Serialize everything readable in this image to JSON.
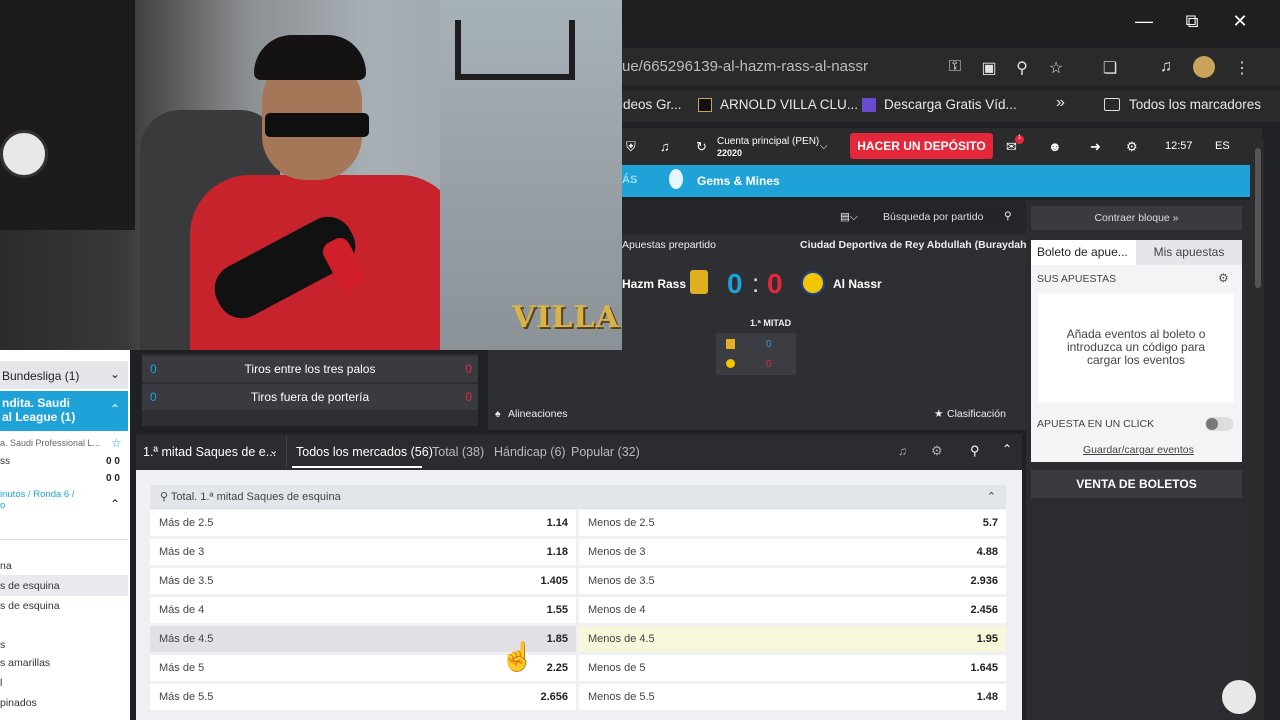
{
  "browser": {
    "url": "ue/665296139-al-hazm-rass-al-nassr",
    "bookmarks": [
      "ideos Gr...",
      "ARNOLD VILLA CLU...",
      "Descarga Gratis Víd...",
      "»",
      "Todos los marcadores"
    ],
    "window_controls": [
      "minimize-icon",
      "restore-icon",
      "close-icon"
    ]
  },
  "site_header": {
    "account_label": "Cuenta principal (PEN)",
    "account_value": "22020",
    "deposit_label": "HACER UN DEPÓSITO",
    "time": "12:57",
    "lang": "ES",
    "notification_count": "1"
  },
  "nav": {
    "mas": "ÁS",
    "gems": "Gems & Mines"
  },
  "match": {
    "search_placeholder": "Búsqueda por partido",
    "prematch": "Apuestas prepartido",
    "venue": "Ciudad Deportiva de Rey Abdullah (Buraydah)",
    "home_team": "Hazm Rass",
    "away_team": "Al Nassr",
    "home_score": "0",
    "away_score": "0",
    "period_label": "1.ª MITAD",
    "period_home": "0",
    "period_away": "0",
    "lineups": "Alineaciones",
    "standings": "Clasificación"
  },
  "left_panel": {
    "league1": "Bundesliga (1)",
    "league2_line1": "ndita. Saudi",
    "league2_line2": "al League (1)",
    "sub_league": "a. Saudi Professional L...",
    "team1": "ss",
    "team1_score": "0 0",
    "team2_score": "0 0",
    "round_line1": "inutos / Ronda 6 /",
    "round_line2": "o",
    "items": [
      "na",
      "s de esquina",
      "s de esquina",
      "s",
      "s amarillas",
      "l",
      "pinados"
    ]
  },
  "stats": [
    {
      "home": "0",
      "label": "Tiros entre los tres palos",
      "away": "0"
    },
    {
      "home": "0",
      "label": "Tiros fuera de portería",
      "away": "0"
    }
  ],
  "markets": {
    "selected": "1.ª mitad Saques de e...",
    "tabs": [
      "Todos los mercados (56)",
      "Total (38)",
      "Hándicap (6)",
      "Popular (32)"
    ],
    "group_title": "Total. 1.ª mitad Saques de esquina",
    "rows": [
      {
        "over": "Más de 2.5",
        "over_odd": "1.14",
        "under": "Menos de 2.5",
        "under_odd": "5.7"
      },
      {
        "over": "Más de 3",
        "over_odd": "1.18",
        "under": "Menos de 3",
        "under_odd": "4.88"
      },
      {
        "over": "Más de 3.5",
        "over_odd": "1.405",
        "under": "Menos de 3.5",
        "under_odd": "2.936"
      },
      {
        "over": "Más de 4",
        "over_odd": "1.55",
        "under": "Menos de 4",
        "under_odd": "2.456"
      },
      {
        "over": "Más de 4.5",
        "over_odd": "1.85",
        "under": "Menos de 4.5",
        "under_odd": "1.95"
      },
      {
        "over": "Más de 5",
        "over_odd": "2.25",
        "under": "Menos de 5",
        "under_odd": "1.645"
      },
      {
        "over": "Más de 5.5",
        "over_odd": "2.656",
        "under": "Menos de 5.5",
        "under_odd": "1.48"
      }
    ]
  },
  "betslip": {
    "collapse": "Contraer bloque",
    "tab1": "Boleto de apue...",
    "tab2": "Mis apuestas",
    "heading": "SUS APUESTAS",
    "empty_text": "Añada eventos al boleto o introduzca un código para cargar los eventos",
    "one_click": "APUESTA EN UN CLICK",
    "save_load": "Guardar/cargar eventos",
    "sell": "VENTA DE BOLETOS"
  },
  "webcam": {
    "logo_text": "VILLA"
  },
  "colors": {
    "accent_blue": "#1ea2d8",
    "deposit_red": "#e4283b",
    "highlight_yellow": "#f8f7dc"
  }
}
